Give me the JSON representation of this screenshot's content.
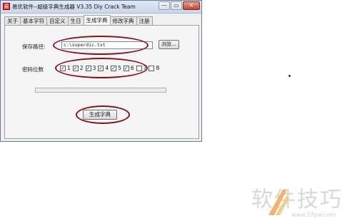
{
  "window": {
    "title": "易优软件--超级字典生成器 V3.35  Diy Crack Team",
    "icon": "app-icon",
    "controls": {
      "minimize": "—",
      "maximize": "▭",
      "close": "✕"
    }
  },
  "tabs": [
    {
      "label": "关于"
    },
    {
      "label": "基本字符"
    },
    {
      "label": "自定义"
    },
    {
      "label": "生日"
    },
    {
      "label": "生成字典"
    },
    {
      "label": "修改字典"
    },
    {
      "label": "注册"
    }
  ],
  "active_tab": "生成字典",
  "save_path": {
    "label": "保存路径:",
    "value": "c:\\superdic.txt",
    "browse_label": "浏览..."
  },
  "digits": {
    "label": "密码位数",
    "options": [
      {
        "label": "1",
        "checked": true
      },
      {
        "label": "2",
        "checked": true
      },
      {
        "label": "3",
        "checked": true
      },
      {
        "label": "4",
        "checked": true
      },
      {
        "label": "5",
        "checked": true
      },
      {
        "label": "6",
        "checked": true
      },
      {
        "label": "7",
        "checked": false
      },
      {
        "label": "8",
        "checked": false
      }
    ]
  },
  "progress": {
    "value": 0
  },
  "generate_label": "生成字典",
  "annotation_color": "#8b1020",
  "watermark": {
    "text": "软件技巧",
    "url": "www.17pw.com"
  }
}
